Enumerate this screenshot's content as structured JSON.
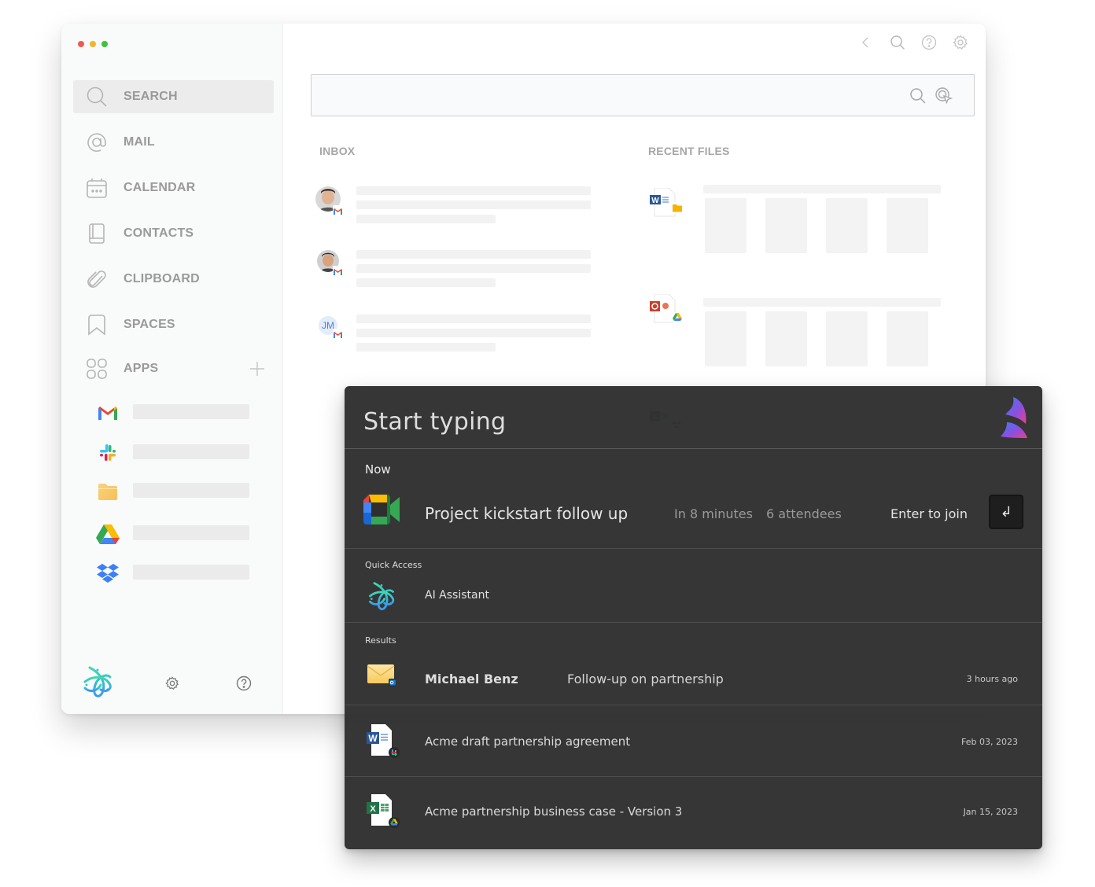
{
  "sidebar": {
    "nav": [
      {
        "id": "search",
        "label": "SEARCH",
        "icon": "search-icon",
        "active": true
      },
      {
        "id": "mail",
        "label": "MAIL",
        "icon": "at-sign-icon"
      },
      {
        "id": "calendar",
        "label": "CALENDAR",
        "icon": "calendar-icon"
      },
      {
        "id": "contacts",
        "label": "CONTACTS",
        "icon": "contacts-book-icon"
      },
      {
        "id": "clipboard",
        "label": "CLIPBOARD",
        "icon": "paperclip-icon"
      },
      {
        "id": "spaces",
        "label": "SPACES",
        "icon": "bookmark-icon"
      },
      {
        "id": "apps",
        "label": "APPS",
        "icon": "apps-grid-icon"
      }
    ],
    "apps": [
      {
        "name": "Gmail",
        "icon": "gmail-icon"
      },
      {
        "name": "Slack",
        "icon": "slack-icon"
      },
      {
        "name": "Files",
        "icon": "folder-icon"
      },
      {
        "name": "Google Drive",
        "icon": "google-drive-icon"
      },
      {
        "name": "Dropbox",
        "icon": "dropbox-icon"
      }
    ],
    "add_app_icon": "plus-icon"
  },
  "topbar": {
    "icons": [
      "chevron-left-icon",
      "search-icon",
      "help-icon",
      "gear-icon"
    ]
  },
  "search": {
    "value": "",
    "placeholder": ""
  },
  "inbox": {
    "label": "INBOX",
    "items": [
      {
        "avatar": "photo",
        "source": "gmail"
      },
      {
        "avatar": "photo",
        "source": "gmail"
      },
      {
        "avatar_initials": "JM",
        "source": "gmail"
      }
    ]
  },
  "recent_files": {
    "label": "RECENT FILES",
    "items": [
      {
        "type": "word",
        "source": "google-drive-folder"
      },
      {
        "type": "powerpoint",
        "source": "google-drive"
      },
      {
        "type": "excel",
        "source": "dropbox"
      }
    ]
  },
  "launcher": {
    "placeholder": "Start typing",
    "value": "",
    "now": {
      "heading": "Now",
      "title": "Project kickstart follow up",
      "time": "In 8 minutes",
      "attendees": "6 attendees",
      "action": "Enter to join",
      "key": "↲",
      "colors": {
        "text": "#e6e6e6",
        "muted": "#9a9a9a"
      }
    },
    "quick_access": {
      "heading": "Quick Access",
      "items": [
        {
          "label": "AI Assistant",
          "icon": "ai-assistant-icon"
        }
      ]
    },
    "results": {
      "heading": "Results",
      "items": [
        {
          "title": "Michael Benz",
          "subtitle": "Follow-up on partnership",
          "date": "3 hours ago",
          "icon": "email-icon",
          "source": "outlook"
        },
        {
          "title": "Acme draft partnership agreement",
          "subtitle": "",
          "date": "Feb 03, 2023",
          "icon": "word-doc-icon",
          "source": "slack"
        },
        {
          "title": "Acme partnership business case - Version 3",
          "subtitle": "",
          "date": "Jan 15, 2023",
          "icon": "excel-doc-icon",
          "source": "google-drive"
        }
      ]
    }
  }
}
